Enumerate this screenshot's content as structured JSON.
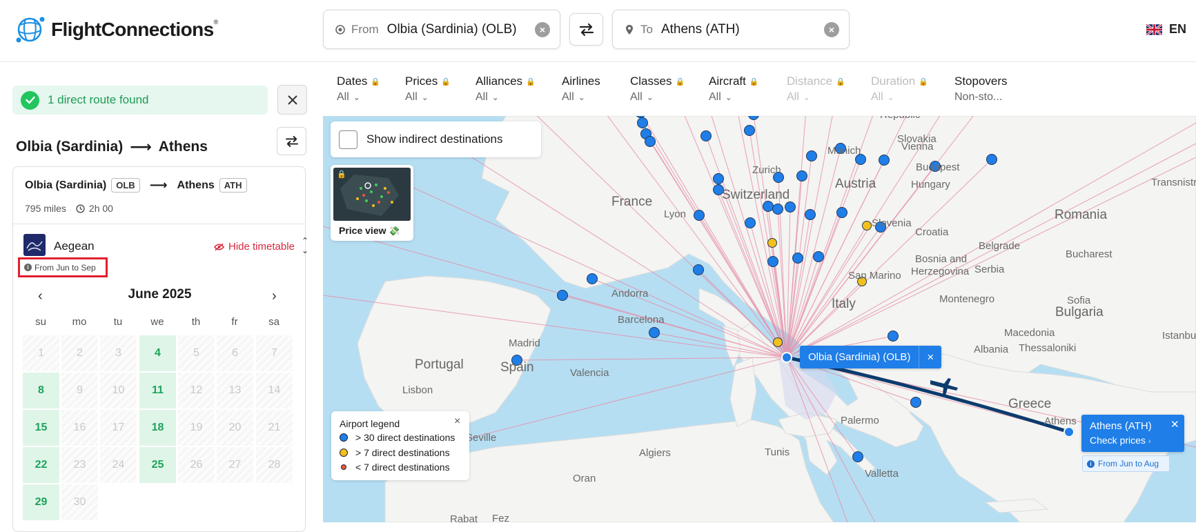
{
  "header": {
    "logo_text": "FlightConnections",
    "logo_mark": "®",
    "from_label": "From",
    "from_value": "Olbia (Sardinia) (OLB)",
    "to_label": "To",
    "to_value": "Athens (ATH)",
    "language": "EN"
  },
  "filters": [
    {
      "name": "Dates",
      "value": "All",
      "locked": true,
      "disabled": false
    },
    {
      "name": "Prices",
      "value": "All",
      "locked": true,
      "disabled": false
    },
    {
      "name": "Alliances",
      "value": "All",
      "locked": true,
      "disabled": false
    },
    {
      "name": "Airlines",
      "value": "All",
      "locked": false,
      "disabled": false
    },
    {
      "name": "Classes",
      "value": "All",
      "locked": true,
      "disabled": false
    },
    {
      "name": "Aircraft",
      "value": "All",
      "locked": true,
      "disabled": false
    },
    {
      "name": "Distance",
      "value": "All",
      "locked": true,
      "disabled": true
    },
    {
      "name": "Duration",
      "value": "All",
      "locked": true,
      "disabled": true
    },
    {
      "name": "Stopovers",
      "value": "Non-sto...",
      "locked": false,
      "disabled": false
    }
  ],
  "panel": {
    "found_text": "1 direct route found",
    "route_from": "Olbia (Sardinia)",
    "route_to": "Athens",
    "card": {
      "from_city": "Olbia (Sardinia)",
      "from_code": "OLB",
      "to_city": "Athens",
      "to_code": "ATH",
      "distance": "795 miles",
      "duration": "2h 00",
      "airline": "Aegean",
      "hide_timetable": "Hide timetable",
      "season": "From Jun to Sep"
    },
    "calendar": {
      "month": "June 2025",
      "weekdays": [
        "su",
        "mo",
        "tu",
        "we",
        "th",
        "fr",
        "sa"
      ],
      "weeks": [
        [
          {
            "d": "1",
            "on": false
          },
          {
            "d": "2",
            "on": false
          },
          {
            "d": "3",
            "on": false
          },
          {
            "d": "4",
            "on": true
          },
          {
            "d": "5",
            "on": false
          },
          {
            "d": "6",
            "on": false
          },
          {
            "d": "7",
            "on": false
          }
        ],
        [
          {
            "d": "8",
            "on": true
          },
          {
            "d": "9",
            "on": false
          },
          {
            "d": "10",
            "on": false
          },
          {
            "d": "11",
            "on": true
          },
          {
            "d": "12",
            "on": false
          },
          {
            "d": "13",
            "on": false
          },
          {
            "d": "14",
            "on": false
          }
        ],
        [
          {
            "d": "15",
            "on": true
          },
          {
            "d": "16",
            "on": false
          },
          {
            "d": "17",
            "on": false
          },
          {
            "d": "18",
            "on": true
          },
          {
            "d": "19",
            "on": false
          },
          {
            "d": "20",
            "on": false
          },
          {
            "d": "21",
            "on": false
          }
        ],
        [
          {
            "d": "22",
            "on": true
          },
          {
            "d": "23",
            "on": false
          },
          {
            "d": "24",
            "on": false
          },
          {
            "d": "25",
            "on": true
          },
          {
            "d": "26",
            "on": false
          },
          {
            "d": "27",
            "on": false
          },
          {
            "d": "28",
            "on": false
          }
        ],
        [
          {
            "d": "29",
            "on": true
          },
          {
            "d": "30",
            "on": false
          }
        ]
      ]
    }
  },
  "map": {
    "show_indirect": "Show indirect destinations",
    "price_view": "Price view",
    "legend": {
      "title": "Airport legend",
      "items": [
        {
          "label": "> 30 direct destinations",
          "color": "#1f7ee8"
        },
        {
          "label": "> 7 direct destinations",
          "color": "#f3c01c"
        },
        {
          "label": "< 7 direct destinations",
          "color": "#e65a3a"
        }
      ]
    },
    "origin_popup": "Olbia (Sardinia) (OLB)",
    "dest_popup": {
      "name": "Athens (ATH)",
      "cta": "Check prices",
      "season": "From Jun to Aug"
    },
    "labels": {
      "france": "France",
      "switzerland": "Switzerland",
      "austria": "Austria",
      "slovakia": "Slovakia",
      "vienna": "Vienna",
      "budapest": "Budapest",
      "hungary": "Hungary",
      "transnistria": "Transnistr",
      "romania": "Romania",
      "bucharest": "Bucharest",
      "croatia": "Croatia",
      "belgrade": "Belgrade",
      "slovenia": "Slovenia",
      "bosnia": "Bosnia and",
      "herzegovina": "Herzegovina",
      "serbia": "Serbia",
      "montenegro": "Montenegro",
      "sofia": "Sofia",
      "bulgaria": "Bulgaria",
      "macedonia": "Macedonia",
      "albania": "Albania",
      "thessaloniki": "Thessaloniki",
      "istanbul": "Istanbul",
      "greece": "Greece",
      "athens": "Athens",
      "italy": "Italy",
      "sanmarino": "San Marino",
      "andorra": "Andorra",
      "barcelona": "Barcelona",
      "madrid": "Madrid",
      "spain": "Spain",
      "portugal": "Portugal",
      "lisbon": "Lisbon",
      "valencia": "Valencia",
      "seville": "Seville",
      "algiers": "Algiers",
      "tunis": "Tunis",
      "palermo": "Palermo",
      "valletta": "Valletta",
      "oran": "Oran",
      "rabat": "Rabat",
      "fez": "Fez",
      "munich": "Munich",
      "zurich": "Zurich",
      "lyon": "Lyon",
      "republic": "Republic"
    }
  }
}
